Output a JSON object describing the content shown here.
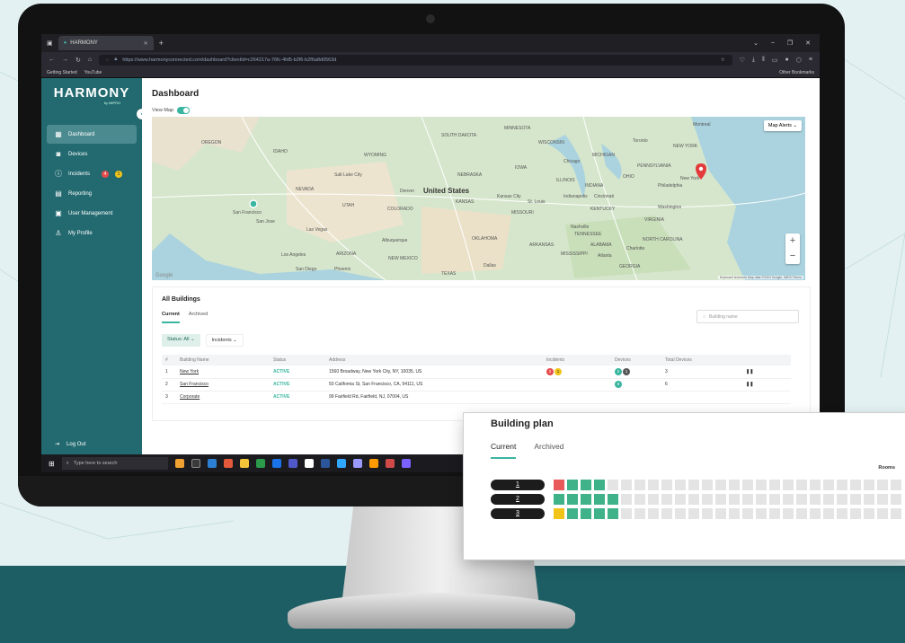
{
  "browser": {
    "tab_title": "HARMONY",
    "url": "https://www.harmonyconnected.com/dashboard?clientId=c264217a-76fc-4fd5-b2f6-b2f6a8d0563d",
    "bookmarks": [
      "Getting Started",
      "YouTube"
    ],
    "other_bookmarks": "Other Bookmarks"
  },
  "sidebar": {
    "logo": "HARMONY",
    "logo_sub": "by MIPRO",
    "items": [
      {
        "label": "Dashboard",
        "icon": "grid-icon"
      },
      {
        "label": "Devices",
        "icon": "device-icon"
      },
      {
        "label": "Incidents",
        "icon": "alert-circle-icon"
      },
      {
        "label": "Reporting",
        "icon": "report-icon"
      },
      {
        "label": "User Management",
        "icon": "users-icon"
      },
      {
        "label": "My Profile",
        "icon": "person-icon"
      }
    ],
    "incident_badges": [
      "4",
      "1"
    ],
    "logout": "Log Out"
  },
  "main": {
    "title": "Dashboard",
    "view_map_label": "View Map",
    "map": {
      "alerts_label": "Map Alerts",
      "country_label": "United States",
      "labels": [
        "Montreal",
        "Toronto",
        "Chicago",
        "Denver",
        "Kansas City",
        "St. Louis",
        "Indianapolis",
        "Cincinnati",
        "Philadelphia",
        "New York",
        "Washington",
        "Nashville",
        "Atlanta",
        "Charlotte",
        "Dallas",
        "Albuquerque",
        "Las Vegas",
        "Los Angeles",
        "San Diego",
        "Phoenix",
        "San Francisco",
        "San Jose",
        "Salt Lake City",
        "NEVADA",
        "UTAH",
        "COLORADO",
        "KANSAS",
        "MISSOURI",
        "OKLAHOMA",
        "ARIZONA",
        "NEW MEXICO",
        "OREGON",
        "IDAHO",
        "WYOMING",
        "NEBRASKA",
        "SOUTH DAKOTA",
        "IOWA",
        "ILLINOIS",
        "INDIANA",
        "OHIO",
        "KENTUCKY",
        "TENNESSEE",
        "VIRGINIA",
        "NORTH CAROLINA",
        "GEORGIA",
        "ALABAMA",
        "MISSISSIPPI",
        "ARKANSAS",
        "TEXAS",
        "MINNESOTA",
        "WISCONSIN",
        "MICHIGAN",
        "PENNSYLVANIA",
        "NEW YORK"
      ],
      "footer": "Keyboard shortcuts   Map data ©2024 Google, INEGI   Terms",
      "google": "Google"
    },
    "buildings": {
      "title": "All Buildings",
      "tabs": [
        "Current",
        "Archived"
      ],
      "search_placeholder": "Building name",
      "filter_status": "Status: All",
      "filter_incidents": "Incidents",
      "columns": [
        "#",
        "Building Name",
        "Status",
        "Address",
        "Incidents",
        "Devices",
        "Total Devices",
        ""
      ],
      "rows": [
        {
          "num": "1",
          "name": "New York",
          "status": "ACTIVE",
          "address": "1560 Broadway, New York City, NY, 10035, US",
          "incidents": [
            "2",
            "1"
          ],
          "devices": [
            "2",
            "1"
          ],
          "total": "3"
        },
        {
          "num": "2",
          "name": "San Francisco",
          "status": "ACTIVE",
          "address": "50 California St, San Francisco, CA, 94111, US",
          "incidents": [],
          "devices": [
            "6"
          ],
          "total": "6"
        },
        {
          "num": "3",
          "name": "Corporate",
          "status": "ACTIVE",
          "address": "99 Fairfield Rd, Fairfield, NJ, 07004, US",
          "incidents": [],
          "devices": [],
          "total": ""
        }
      ]
    }
  },
  "taskbar": {
    "search_placeholder": "Type here to search"
  },
  "plan": {
    "title": "Building plan",
    "tabs": [
      "Current",
      "Archived"
    ],
    "rooms_label": "Rooms",
    "floors": [
      {
        "label": "1",
        "cells": [
          "r",
          "g",
          "g",
          "g"
        ]
      },
      {
        "label": "2",
        "cells": [
          "g",
          "g",
          "g",
          "g",
          "g"
        ]
      },
      {
        "label": "3",
        "cells": [
          "y",
          "g",
          "g",
          "g",
          "g"
        ]
      }
    ]
  },
  "colors": {
    "sidebar": "#236a70",
    "accent": "#39b5a0",
    "floor": "#1d5e64"
  }
}
